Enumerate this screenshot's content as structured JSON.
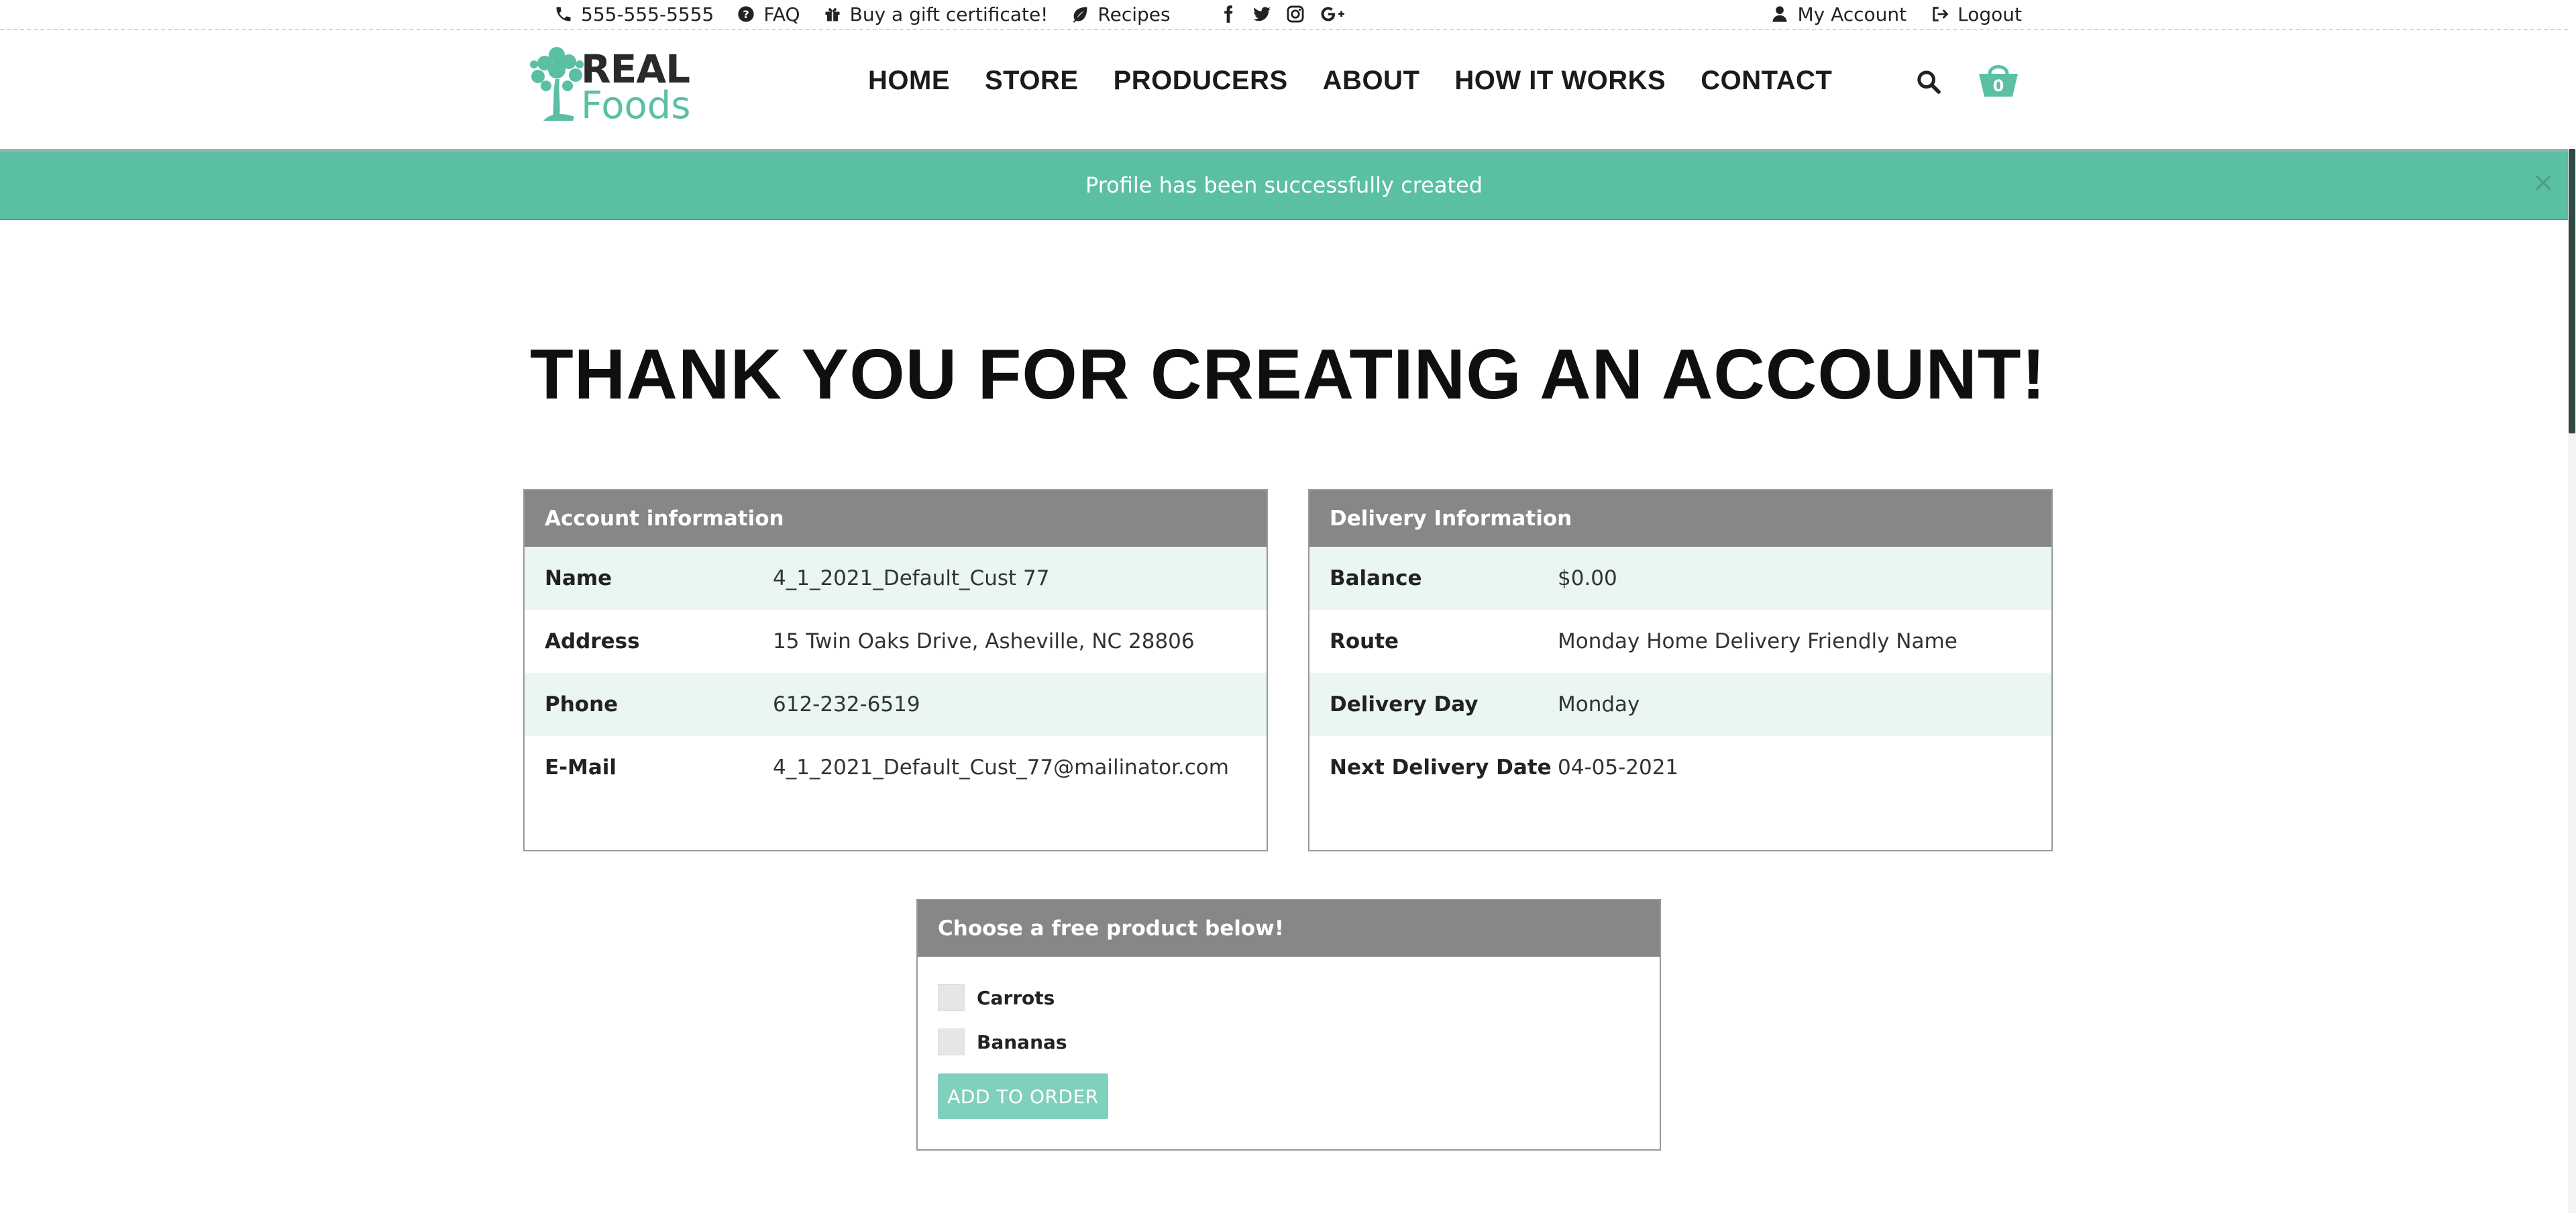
{
  "topbar": {
    "phone": "555-555-5555",
    "faq": "FAQ",
    "gift": "Buy a gift certificate!",
    "recipes": "Recipes",
    "my_account": "My Account",
    "logout": "Logout",
    "social_icons": [
      "facebook-icon",
      "twitter-icon",
      "instagram-icon",
      "google-plus-icon"
    ]
  },
  "logo": {
    "line1": "REAL",
    "line2": "Foods"
  },
  "nav": {
    "items": [
      "HOME",
      "STORE",
      "PRODUCERS",
      "ABOUT",
      "HOW IT WORKS",
      "CONTACT"
    ]
  },
  "cart": {
    "count": "0"
  },
  "alert": {
    "message": "Profile has been successfully created",
    "close": "×"
  },
  "page": {
    "title": "THANK YOU FOR CREATING AN ACCOUNT!"
  },
  "account": {
    "heading": "Account information",
    "rows": [
      {
        "label": "Name",
        "value": "4_1_2021_Default_Cust 77"
      },
      {
        "label": "Address",
        "value": "15 Twin Oaks Drive, Asheville, NC 28806"
      },
      {
        "label": "Phone",
        "value": "612-232-6519"
      },
      {
        "label": "E-Mail",
        "value": "4_1_2021_Default_Cust_77@mailinator.com"
      }
    ]
  },
  "delivery": {
    "heading": "Delivery Information",
    "rows": [
      {
        "label": "Balance",
        "value": "$0.00"
      },
      {
        "label": "Route",
        "value": "Monday Home Delivery Friendly Name"
      },
      {
        "label": "Delivery Day",
        "value": "Monday"
      },
      {
        "label": "Next Delivery Date",
        "value": "04-05-2021"
      }
    ]
  },
  "free_product": {
    "heading": "Choose a free product below!",
    "options": [
      "Carrots",
      "Bananas"
    ],
    "button": "ADD TO ORDER"
  },
  "colors": {
    "accent": "#5bbfa4",
    "card_header": "#878787",
    "row_alt": "#eaf6f3",
    "button": "#7fd0bd"
  }
}
